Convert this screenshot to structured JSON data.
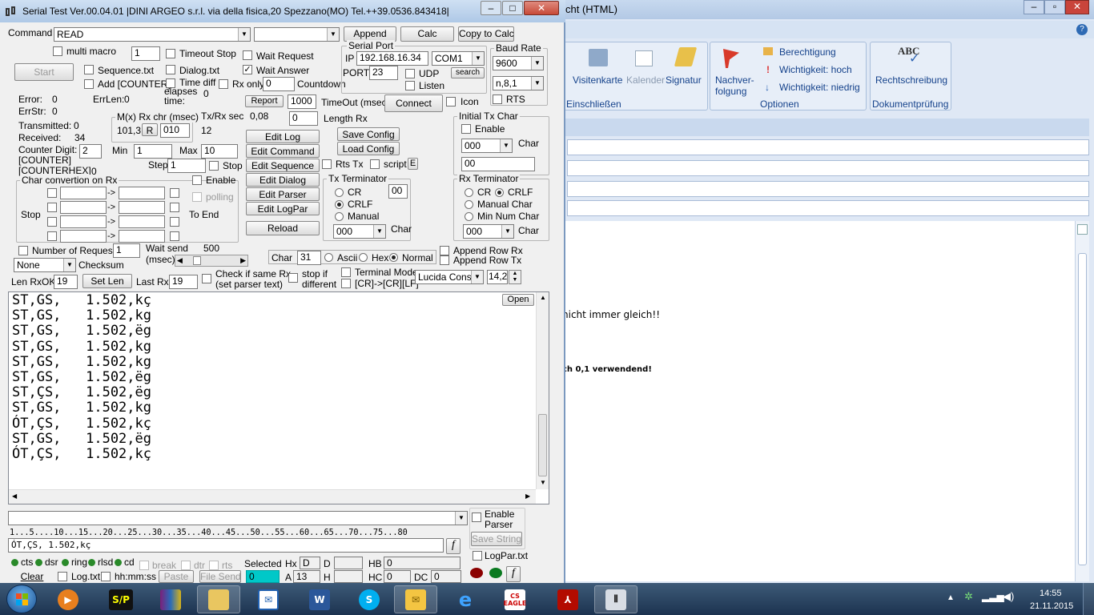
{
  "window": {
    "title": "Serial Test Ver.00.04.01 |DINI ARGEO s.r.l. via della fisica,20 Spezzano(MO) Tel.++39.0536.843418|",
    "min": "–",
    "max": "□",
    "close": "✕"
  },
  "outlook": {
    "title": "cht (HTML)",
    "ribbon": {
      "visitenkarte": "Visitenkarte",
      "kalender": "Kalender",
      "signatur": "Signatur",
      "einschliessen": "Einschließen",
      "nachverfolgung_1": "Nachver-",
      "nachverfolgung_2": "folgung",
      "berechtigung": "Berechtigung",
      "wichtig_hoch": "Wichtigkeit: hoch",
      "wichtig_niedrig": "Wichtigkeit: niedrig",
      "optionen": "Optionen",
      "rechtschreibung": "Rechtschreibung",
      "abc": "ABC",
      "dokumentpruefung": "Dokumentprüfung"
    },
    "body_line1": "nicht immer gleich!!",
    "body_line2": "ch 0,1 verwendend!"
  },
  "top": {
    "command_label": "Command",
    "command_value": "READ",
    "append": "Append",
    "calc": "Calc",
    "copy_to_calc": "Copy to Calc",
    "multi_macro": "multi macro",
    "multi_macro_value": "1",
    "timeout_stop": "Timeout Stop",
    "wait_request": "Wait Request",
    "start": "Start",
    "sequence_txt": "Sequence.txt",
    "dialog_txt": "Dialog.txt",
    "wait_answer": "Wait Answer",
    "add_counter": "Add [COUNTER]",
    "time_diff": "Time diff",
    "elapses_time": "elapses time:",
    "elapses_value": "0",
    "rx_only": "Rx only",
    "rx_only_value": "0",
    "countdown": "Countdown",
    "serial_port": "Serial Port",
    "ip_label": "IP",
    "ip_value": "192.168.16.34",
    "com_value": "COM1",
    "port_label": "PORT",
    "port_value": "23",
    "udp": "UDP",
    "search": "search",
    "listen": "Listen",
    "connect": "Connect",
    "icon": "Icon",
    "baud_rate": "Baud Rate",
    "baud_value": "9600",
    "parity_value": "n,8,1",
    "rts": "RTS",
    "report": "Report",
    "report_value": "1000",
    "timeout_msec": "TimeOut (msec)"
  },
  "status": {
    "error_label": "Error:",
    "error_value": "0",
    "errlen_label": "ErrLen:",
    "errlen_value": "0",
    "errstr_label": "ErrStr:",
    "errstr_value": "0",
    "transmitted_label": "Transmitted:",
    "transmitted_value": "0",
    "received_label": "Received:",
    "received_value": "34",
    "counter_digit_label": "Counter Digit:",
    "counter_digit_value": "2",
    "counter": "[COUNTER]",
    "counterhex": "[COUNTERHEX]",
    "counterhex_value": "0",
    "mx_label": "M(x) Rx chr (msec)",
    "mx_value": "101,3",
    "r_btn": "R",
    "mx_input": "010",
    "txrx_label": "Tx/Rx sec",
    "txrx_value": "0,08",
    "txrx_12": "12",
    "len_rx_value": "0",
    "len_rx_label": "Length Rx",
    "min_label": "Min",
    "min_value": "1",
    "max_label": "Max",
    "max_value": "10",
    "step_label": "Step",
    "step_value": "1",
    "stop": "Stop"
  },
  "edit_buttons": [
    "Edit Log",
    "Edit Command",
    "Edit Sequence",
    "Edit Dialog",
    "Edit Parser",
    "Edit LogPar"
  ],
  "reload": "Reload",
  "config": {
    "save": "Save Config",
    "load": "Load Config",
    "rts_tx": "Rts Tx",
    "script": "script",
    "e": "E"
  },
  "tx_term": {
    "title": "Tx Terminator",
    "cr": "CR",
    "crlf": "CRLF",
    "manual": "Manual",
    "value": "00",
    "dd": "000",
    "char": "Char"
  },
  "init_tx": {
    "title": "Initial Tx Char",
    "enable": "Enable",
    "dd": "000",
    "char": "Char",
    "value": "00"
  },
  "rx_term": {
    "title": "Rx Terminator",
    "cr": "CR",
    "crlf": "CRLF",
    "manual_char": "Manual Char",
    "min_num_char": "Min Num Char",
    "dd": "000",
    "char": "Char"
  },
  "char_conv": {
    "title": "Char convertion on Rx",
    "stop": "Stop",
    "enable": "Enable",
    "polling": "polling",
    "to_end": "To End"
  },
  "lower": {
    "num_request": "Number of Request",
    "num_request_value": "1",
    "wait_send": "Wait send",
    "msec": "(msec)",
    "wait_send_value": "500",
    "none": "None",
    "checksum": "Checksum",
    "char_label": "Char",
    "char_value": "31",
    "ascii": "Ascii",
    "hex": "Hex",
    "normal": "Normal",
    "append_rx": "Append Row Rx",
    "append_tx": "Append Row Tx",
    "len_rxok": "Len RxOK",
    "len_rxok_value": "19",
    "set_len": "Set Len",
    "last_rx": "Last Rx",
    "last_rx_value": "19",
    "check_same_1": "Check if same Rx",
    "check_same_2": "(set parser text)",
    "stop_if_1": "stop if",
    "stop_if_2": "different",
    "terminal_mode": "Terminal Mode",
    "crlf_conv": "[CR]->[CR][LF]",
    "font": "Lucida Consc",
    "font_size": "14,2"
  },
  "output": {
    "open": "Open",
    "lines": [
      "ST,GS,   1.502,kç",
      "ST,GS,   1.502,kg",
      "ST,GS,   1.502,ëg",
      "ST,GS,   1.502,kg",
      "ST,GS,   1.502,kg",
      "ST,GS,   1.502,ëg",
      "ST,ÇS,   1.502,ëg",
      "ST,GS,   1.502,kg",
      "ÓT,ÇS,   1.502,kç",
      "ST,GS,   1.502,ëg",
      "ÓT,ÇS,   1.502,kç"
    ]
  },
  "parser": {
    "enable_1": "Enable",
    "enable_2": "Parser",
    "save_string": "Save String",
    "ruler": "1...5....10...15...20...25...30...35...40...45...50...55...60...65...70...75...80",
    "text": "ÓT,ÇS,   1.502,kç",
    "f": "f",
    "logpar": "LogPar.txt"
  },
  "bottom": {
    "cts": "cts",
    "dsr": "dsr",
    "ring": "ring",
    "rlsd": "rlsd",
    "cd": "cd",
    "brk": "break",
    "dtr": "dtr",
    "rts": "rts",
    "selected": "Selected",
    "hx": "Hx",
    "hx_value": "D",
    "d": "D",
    "h": "H",
    "a": "A",
    "a_value": "13",
    "hb": "HB",
    "hb_value": "0",
    "hc": "HC",
    "hc_value": "0",
    "dc": "DC",
    "dc_value": "0",
    "clear": "Clear",
    "log_txt": "Log.txt",
    "hhmmss": "hh:mm:ss",
    "paste": "Paste",
    "file_send": "File Send",
    "sel_value": "0"
  },
  "taskbar": {
    "icons": [
      "windows-start-icon",
      "media-player-icon",
      "sp-app-icon",
      "winrar-icon",
      "explorer-folder-icon",
      "mail-icon",
      "word-icon",
      "skype-icon",
      "outlook-icon",
      "internet-explorer-icon",
      "cs-eagle-icon",
      "acrobat-icon",
      "serial-test-icon"
    ],
    "sp": "S/P",
    "eagle": "EAGLE",
    "cs": "CS",
    "time": "14:55",
    "date": "21.11.2015"
  },
  "colors": {
    "accent": "#1f5fa8",
    "taskbar": "#1c3350",
    "win_title": "#bfd3ea",
    "selected_cyan": "#00c8c8"
  }
}
